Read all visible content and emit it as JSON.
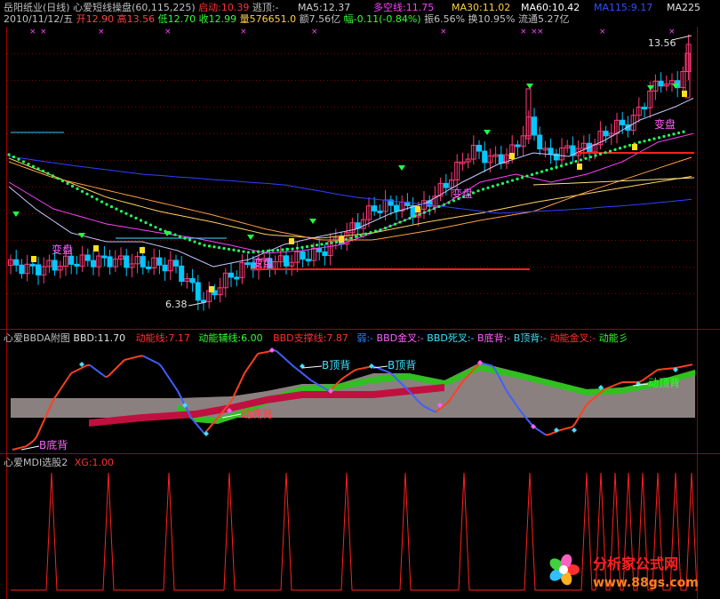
{
  "main_header": {
    "stock_name": "岳阳纸业(日线)",
    "indicator": "心爱短线操盘(60,115,225)",
    "startup_label": "启动:10.39",
    "escape_label": "逃顶:-",
    "ma5": "MA5:12.37",
    "long_short": "多空线:11.75",
    "ma30": "MA30:11.02",
    "ma60": "MA60:10.42",
    "ma115": "MA115:9.17",
    "ma225": "MA225"
  },
  "info_line": {
    "date": "2010/11/12/五",
    "open": "开12.90",
    "high": "高13.56",
    "low": "低12.70",
    "close": "收12.99",
    "volume": "量576651.0",
    "amount": "额7.56亿",
    "change": "幅-0.11(-0.84%)",
    "amplitude": "振6.56%",
    "turnover": "换10.95%",
    "float_cap": "流通5.27亿"
  },
  "price_annotations": {
    "high_price": "13.56",
    "low_price": "6.38",
    "change_plate_1": "变盘",
    "change_plate_2": "变盘",
    "change_plate_3": "变盘",
    "change_plate_4": "变盘"
  },
  "sub1_header": {
    "name": "心爱BBDA附图",
    "bbd": "BBD:11.70",
    "energy": "动能线:7.17",
    "energy_aux": "动能辅线:6.00",
    "support": "BBD支撑线:7.87",
    "weak": "弱:-",
    "bbd_golden": "BBD金叉:-",
    "bbd_dead": "BBD死叉:-",
    "b_bottom": "B底背:-",
    "b_top": "B顶背:-",
    "energy_golden": "动能金叉:-",
    "energy_more": "动能彡"
  },
  "sub1_annotations": {
    "b_top_1": "B顶背",
    "b_top_2": "B顶背",
    "b_bottom": "B底背",
    "energy_bottom": "动底背",
    "energy_top": "动顶背"
  },
  "sub2_header": {
    "name": "心爱MDI选股2",
    "xg": "XG:1.00"
  },
  "watermark": {
    "title": "分析家公式网",
    "url": "www.88gs.com"
  },
  "colors": {
    "background": "#000000",
    "up_candle": "#ff3b7a",
    "down_candle": "#00c8ff",
    "ma_white": "#c8c8ff",
    "ma_orange": "#ffa040",
    "ma_blue": "#3040ff",
    "ma_yellow": "#ffd060",
    "dot_green": "#20ff60",
    "signal_red": "#ff2020",
    "bbd_red": "#ff4020",
    "bbd_blue": "#4060ff",
    "gray_fill": "#8a8080",
    "green_fill": "#30c020",
    "crimson_fill": "#c01040"
  },
  "chart_data": {
    "type": "line",
    "price_axis": {
      "min": 6.38,
      "max": 13.56
    },
    "series": [],
    "xg_signal_values": [
      0,
      1
    ]
  }
}
